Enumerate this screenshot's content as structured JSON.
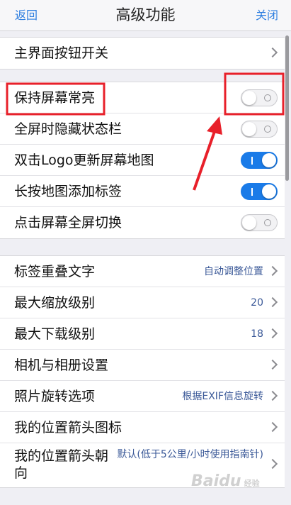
{
  "header": {
    "back_label": "返回",
    "title": "高级功能",
    "close_label": "关闭"
  },
  "group1": {
    "items": [
      {
        "label": "主界面按钮开关"
      }
    ]
  },
  "group2": {
    "items": [
      {
        "label": "保持屏幕常亮",
        "toggle": "off"
      },
      {
        "label": "全屏时隐藏状态栏",
        "toggle": "off"
      },
      {
        "label": "双击Logo更新屏幕地图",
        "toggle": "on"
      },
      {
        "label": "长按地图添加标签",
        "toggle": "on"
      },
      {
        "label": "点击屏幕全屏切换",
        "toggle": "off"
      }
    ]
  },
  "group3": {
    "items": [
      {
        "label": "标签重叠文字",
        "value": "自动调整位置"
      },
      {
        "label": "最大缩放级别",
        "value": "20"
      },
      {
        "label": "最大下载级别",
        "value": "18"
      },
      {
        "label": "相机与相册设置",
        "value": ""
      },
      {
        "label": "照片旋转选项",
        "value": "根据EXIF信息旋转"
      },
      {
        "label": "我的位置箭头图标",
        "value": ""
      },
      {
        "label": "我的位置箭头朝向",
        "value": "默认(低于5公里/小时使用指南针)"
      }
    ]
  },
  "watermark": {
    "text": "Baidu",
    "subtext": "经验"
  },
  "annotation_color": "#e8202a",
  "accent_color": "#1a7be8"
}
